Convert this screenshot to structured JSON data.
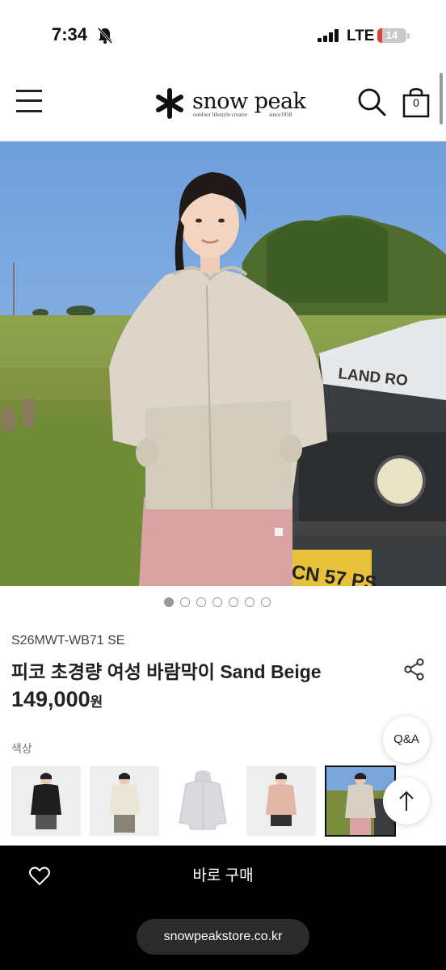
{
  "status_bar": {
    "time": "7:34",
    "network": "LTE",
    "battery": "14"
  },
  "header": {
    "logo_text": "snow peak",
    "logo_tagline": "outdoor lifestyle creator",
    "logo_since": "since1958",
    "cart_count": "0"
  },
  "hero": {
    "slide_count": 7,
    "active_slide": 1,
    "vehicle_text": "LAND RO",
    "plate_text": "CN 57 PS"
  },
  "product": {
    "sku": "S26MWT-WB71 SE",
    "title": "피코 초경량 여성 바람막이 Sand Beige",
    "price": "149,000",
    "price_unit": "원",
    "color_label": "색상",
    "color_options": [
      {
        "name": "black-jacket",
        "color": "#1e1e1e"
      },
      {
        "name": "ivory-jacket",
        "color": "#e9e6d6"
      },
      {
        "name": "grey-jacket",
        "color": "#d9d9de"
      },
      {
        "name": "pink-jacket",
        "color": "#e3b6a7"
      },
      {
        "name": "sand-beige-jacket",
        "color": "#d8d0c2"
      }
    ],
    "selected_color_index": 4
  },
  "floating": {
    "qa_label": "Q&A"
  },
  "bottom_bar": {
    "buy_label": "바로 구매",
    "url": "snowpeakstore.co.kr"
  }
}
